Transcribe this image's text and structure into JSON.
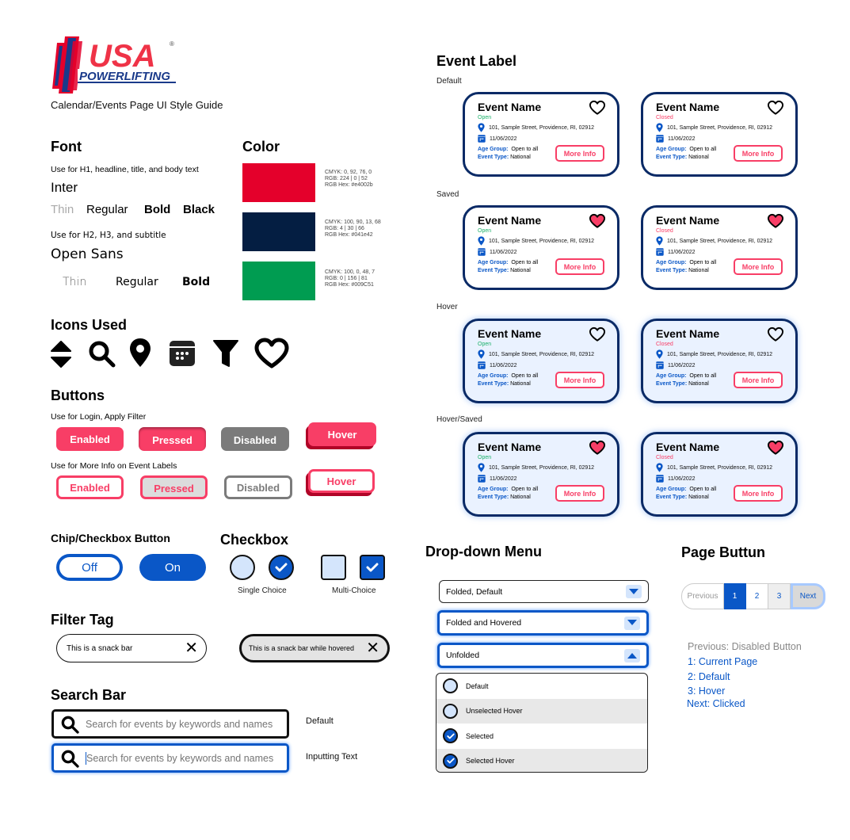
{
  "header": {
    "logo_main": "USA",
    "logo_sub": "POWERLIFTING",
    "subtitle": "Calendar/Events Page UI Style Guide"
  },
  "font": {
    "title": "Font",
    "inter_usage": "Use for H1, headline, title, and body text",
    "inter_name": "Inter",
    "inter_weights": [
      "Thin",
      "Regular",
      "Bold",
      "Black"
    ],
    "opensans_usage": "Use for H2, H3, and subtitle",
    "opensans_name": "Open Sans",
    "opensans_weights": [
      "Thin",
      "Regular",
      "Bold"
    ]
  },
  "color": {
    "title": "Color",
    "swatches": [
      {
        "hex": "#e4002b",
        "cmyk": "CMYK: 0, 92, 76, 0",
        "rgb": "RGB: 224 | 0 | 52",
        "hex_label": "RGB Hex: #e4002b"
      },
      {
        "hex": "#041e42",
        "cmyk": "CMYK: 100, 90, 13, 68",
        "rgb": "RGB: 4 | 30 | 66",
        "hex_label": "RGB Hex: #041e42"
      },
      {
        "hex": "#009c51",
        "cmyk": "CMYK: 100, 0, 48, 7",
        "rgb": "RGB: 0 | 156 | 81",
        "hex_label": "RGB Hex: #009C51"
      }
    ]
  },
  "icons": {
    "title": "Icons Used",
    "list": [
      "sort-icon",
      "search-icon",
      "location-pin-icon",
      "calendar-icon",
      "filter-icon",
      "heart-icon"
    ]
  },
  "buttons": {
    "title": "Buttons",
    "primary_usage": "Use for Login, Apply Filter",
    "secondary_usage": "Use for More Info on Event Labels",
    "states": [
      "Enabled",
      "Pressed",
      "Disabled",
      "Hover"
    ]
  },
  "chip": {
    "title": "Chip/Checkbox Button",
    "off": "Off",
    "on": "On"
  },
  "checkbox": {
    "title": "Checkbox",
    "single_label": "Single Choice",
    "multi_label": "Multi-Choice"
  },
  "filter_tag": {
    "title": "Filter Tag",
    "default": "This is a snack bar",
    "hovered": "This is a snack bar while hovered"
  },
  "search": {
    "title": "Search Bar",
    "placeholder": "Search for events by keywords and names",
    "default_label": "Default",
    "input_label": "Inputting Text"
  },
  "event_label": {
    "title": "Event Label",
    "sections": [
      "Default",
      "Saved",
      "Hover",
      "Hover/Saved"
    ],
    "card": {
      "name": "Event Name",
      "open": "Open",
      "closed": "Closed",
      "address": "101, Sample Street, Providence, RI, 02912",
      "date": "11/06/2022",
      "age_key": "Age Group:",
      "age_val": "Open to all",
      "type_key": "Event Type:",
      "type_val": "National",
      "more": "More Info"
    }
  },
  "dropdown": {
    "title": "Drop-down Menu",
    "folded_default": "Folded, Default",
    "folded_hovered": "Folded and Hovered",
    "unfolded": "Unfolded",
    "items": [
      "Default",
      "Unselected Hover",
      "Selected",
      "Selected Hover"
    ]
  },
  "pager": {
    "title": "Page Buttun",
    "prev": "Previous",
    "pages": [
      "1",
      "2",
      "3"
    ],
    "next": "Next",
    "legend": [
      "Previous: Disabled Button",
      "1: Current Page",
      "2: Default",
      "3: Hover",
      "Next: Clicked"
    ]
  },
  "colors": {
    "accent_pink": "#f83e66",
    "primary_blue": "#0a57c7",
    "navy": "#041e42",
    "open_green": "#1db16a"
  }
}
